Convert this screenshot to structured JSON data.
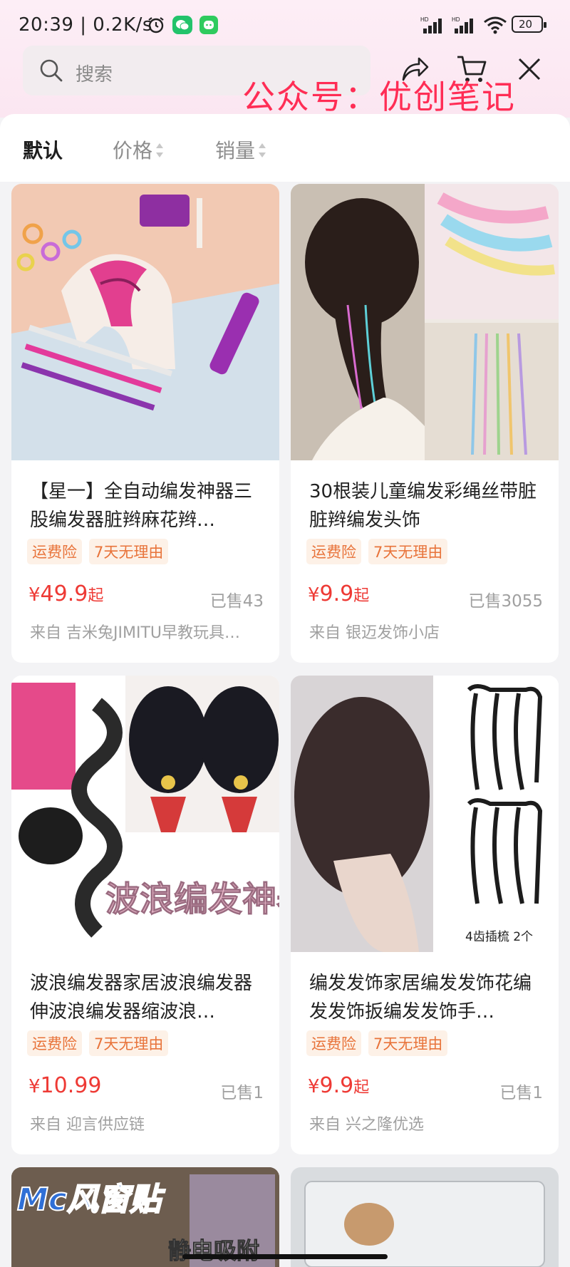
{
  "status_bar": {
    "time": "20:39 | 0.2K/s",
    "battery": "20",
    "icons": [
      "alarm-icon",
      "wechat-icon",
      "message-icon",
      "signal-hd-icon",
      "signal-hd-icon",
      "wifi-icon",
      "battery-icon"
    ]
  },
  "header": {
    "search_placeholder": "搜索",
    "watermark": "公众号：优创笔记",
    "icons": [
      "search-icon",
      "share-icon",
      "cart-icon",
      "close-icon"
    ]
  },
  "sort_tabs": [
    {
      "label": "默认",
      "active": true
    },
    {
      "label": "价格",
      "active": false
    },
    {
      "label": "销量",
      "active": false
    }
  ],
  "tags": [
    "运费险",
    "7天无理由"
  ],
  "products": [
    {
      "title": "【星一】全自动编发神器三股编发器脏辫麻花辫…",
      "price_symbol": "¥",
      "price": "49.9",
      "price_suffix": "起",
      "sold": "已售43",
      "shop": "来自 吉米兔JIMITU早教玩具…"
    },
    {
      "title": "30根装儿童编发彩绳丝带脏脏辫编发头饰",
      "price_symbol": "¥",
      "price": "9.9",
      "price_suffix": "起",
      "sold": "已售3055",
      "shop": "来自 银迈发饰小店"
    },
    {
      "title": "波浪编发器家居波浪编发器伸波浪编发器缩波浪…",
      "price_symbol": "¥",
      "price": "10.99",
      "price_suffix": "",
      "sold": "已售1",
      "shop": "来自 迎言供应链",
      "image_text": "波浪编发神器"
    },
    {
      "title": "编发发饰家居编发发饰花编发发饰扳编发发饰手…",
      "price_symbol": "¥",
      "price": "9.9",
      "price_suffix": "起",
      "sold": "已售1",
      "shop": "来自 兴之隆优选",
      "image_text": "4齿插梳 2个"
    }
  ],
  "next_row_image_texts": [
    "Mc风窗贴",
    "静电吸附"
  ],
  "colors": {
    "price": "#ee3a35",
    "tag_text": "#e8733a",
    "tag_bg": "#fdf1e7",
    "watermark": "#ff2d55",
    "header_bg": "#fdeef6"
  }
}
